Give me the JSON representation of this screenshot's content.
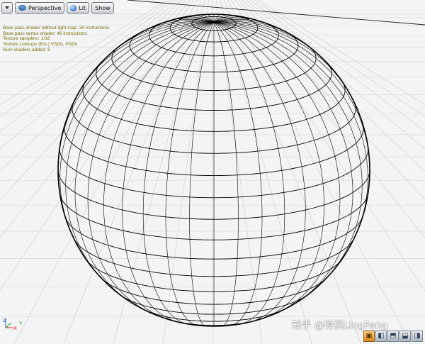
{
  "toolbar": {
    "view_mode": "Perspective",
    "lighting_mode": "Lit",
    "show_label": "Show"
  },
  "stats": [
    "Base pass shader without light map: 34 instructions",
    "Base pass vertex shader: 46 instructions",
    "Texture samplers: 1/16",
    "Texture Lookups (Est.) VS(0), PS(9)",
    "Num shaders added: 6"
  ],
  "axis": {
    "x": "X",
    "y": "Y",
    "z": "Z"
  },
  "watermark": "知乎 @聆枫LingFeng",
  "view_cube_icons": [
    "cube-front-icon",
    "cube-side-icon",
    "cube-top-icon",
    "cube-bottom-icon",
    "cube-back-icon"
  ],
  "colors": {
    "stats_text": "#7a6f00",
    "wire": "#000000",
    "grid": "#d0d0d0",
    "background": "#f3f4f5",
    "active_cube": "#e08b1c"
  }
}
